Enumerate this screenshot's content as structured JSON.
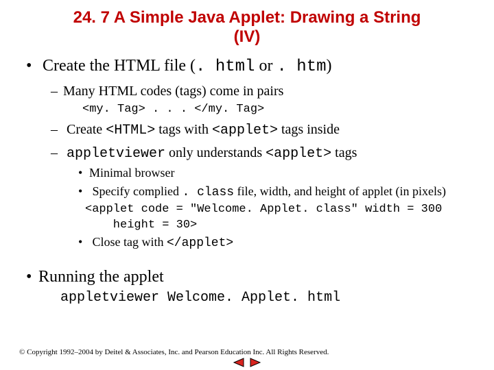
{
  "title_line1": "24. 7   A Simple Java Applet: Drawing a String",
  "title_line2": "(IV)",
  "b1": {
    "pre": "Create the HTML file (",
    "code1": ". html",
    "mid": " or ",
    "code2": ". htm",
    "post": ")"
  },
  "b1_1": "Many HTML codes (tags) come in pairs",
  "code1": "<my. Tag> . . . </my. Tag>",
  "b1_2": {
    "a": "Create ",
    "c1": "<HTML>",
    "b": " tags with ",
    "c2": "<applet>",
    "c": " tags inside"
  },
  "b1_3": {
    "c1": "appletviewer",
    "a": " only understands ",
    "c2": "<applet>",
    "b": " tags"
  },
  "b1_3_1": "Minimal browser",
  "b1_3_2": {
    "a": "Specify complied ",
    "c1": ". class",
    "b": " file, width, and height of applet (in pixels)"
  },
  "code2a": "<applet code = \"Welcome. Applet. class\" width = 300",
  "code2b": "    height = 30>",
  "b1_3_3": {
    "a": "Close tag with ",
    "c1": "</applet>"
  },
  "b2": "Running the applet",
  "run": "appletviewer Welcome. Applet. html",
  "copyright": "© Copyright 1992–2004 by Deitel & Associates, Inc. and Pearson Education Inc. All Rights Reserved.",
  "colors": {
    "nav_fill": "#d8241f",
    "nav_stroke": "#000"
  }
}
